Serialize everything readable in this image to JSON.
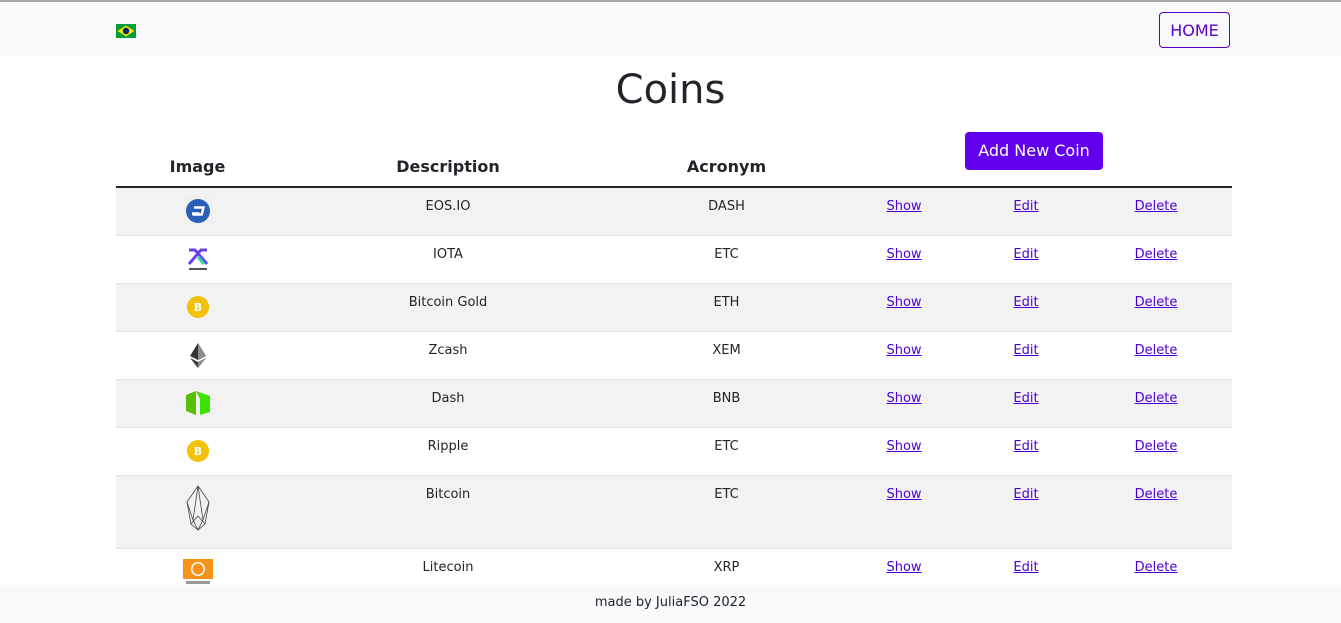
{
  "nav": {
    "home_label": "HOME",
    "flag_icon": "brazil-flag-icon"
  },
  "page": {
    "title": "Coins"
  },
  "table": {
    "headers": {
      "image": "Image",
      "description": "Description",
      "acronym": "Acronym"
    },
    "add_button_label": "Add New Coin",
    "action_labels": {
      "show": "Show",
      "edit": "Edit",
      "delete": "Delete"
    },
    "rows": [
      {
        "icon": "dash-logo-icon",
        "description": "EOS.IO",
        "acronym": "DASH"
      },
      {
        "icon": "decred-logo-icon",
        "description": "IOTA",
        "acronym": "ETC"
      },
      {
        "icon": "bitcoin-gold-logo-icon",
        "description": "Bitcoin Gold",
        "acronym": "ETH"
      },
      {
        "icon": "ethereum-logo-icon",
        "description": "Zcash",
        "acronym": "XEM"
      },
      {
        "icon": "neo-logo-icon",
        "description": "Dash",
        "acronym": "BNB"
      },
      {
        "icon": "bitcoin-gold-logo-icon",
        "description": "Ripple",
        "acronym": "ETC"
      },
      {
        "icon": "eos-logo-icon",
        "description": "Bitcoin",
        "acronym": "ETC"
      },
      {
        "icon": "bitcoin-cash-logo-icon",
        "description": "Litecoin",
        "acronym": "XRP"
      }
    ]
  },
  "footer": {
    "text": "made by JuliaFSO 2022"
  },
  "colors": {
    "accent": "#6200ee",
    "link": "#4b00d1",
    "stripe": "#f2f2f2",
    "navbar": "#f8f9fa"
  }
}
